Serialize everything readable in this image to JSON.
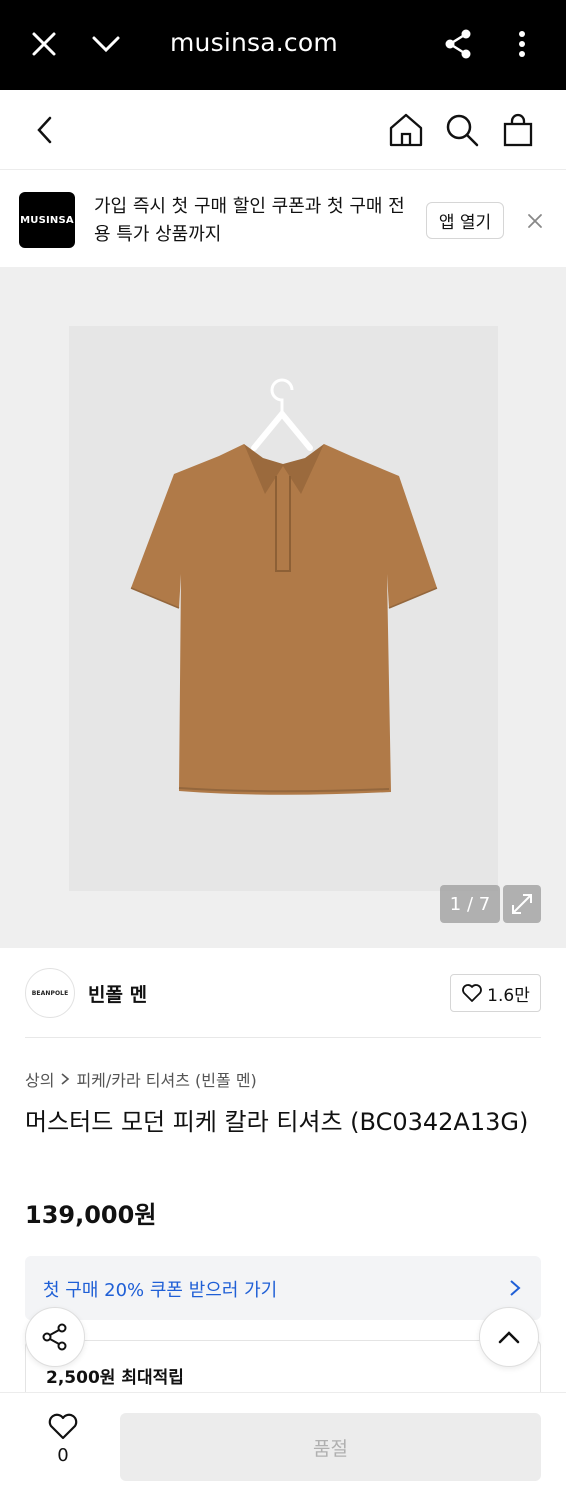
{
  "browser": {
    "url": "musinsa.com"
  },
  "banner": {
    "logo_text": "MUSINSA",
    "message": "가입 즉시 첫 구매 할인 쿠폰과 첫 구매 전용 특가 상품까지",
    "open_app_label": "앱 열기"
  },
  "gallery": {
    "counter": "1 / 7"
  },
  "brand": {
    "logo_text": "BEANPOLE",
    "name": "빈폴 멘",
    "likes": "1.6만"
  },
  "product": {
    "breadcrumb": [
      "상의",
      "피케/카라 티셔츠 (빈폴 멘)"
    ],
    "title": "머스터드 모던 피케 칼라 티셔츠 (BC0342A13G)",
    "price": "139,000원"
  },
  "coupon": {
    "label": "첫 구매 20% 쿠폰 받으러 가기"
  },
  "points": {
    "label": "2,500원 최대적립"
  },
  "bottom": {
    "wish_count": "0",
    "buy_label": "품절"
  },
  "colors": {
    "accent_blue": "#1f5fd6",
    "shirt": "#b07a48"
  }
}
